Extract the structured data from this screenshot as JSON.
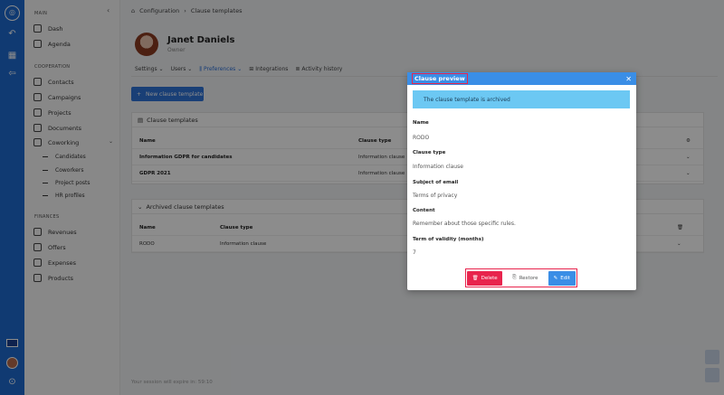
{
  "sidebar": {
    "section_main": "MAIN",
    "section_cooperation": "COOPERATION",
    "section_finances": "FINANCES",
    "main_items": [
      {
        "label": "Dash",
        "icon": "gauge-icon"
      },
      {
        "label": "Agenda",
        "icon": "calendar-icon"
      }
    ],
    "coop_items": [
      {
        "label": "Contacts",
        "icon": "contacts-icon"
      },
      {
        "label": "Campaigns",
        "icon": "megaphone-icon"
      },
      {
        "label": "Projects",
        "icon": "folder-icon"
      },
      {
        "label": "Documents",
        "icon": "document-icon"
      },
      {
        "label": "Coworking",
        "icon": "cog-icon"
      }
    ],
    "coworking_sub": [
      "Candidates",
      "Coworkers",
      "Project posts",
      "HR profiles"
    ],
    "finance_items": [
      {
        "label": "Revenues",
        "icon": "revenue-icon"
      },
      {
        "label": "Offers",
        "icon": "offer-icon"
      },
      {
        "label": "Expenses",
        "icon": "cart-icon"
      },
      {
        "label": "Products",
        "icon": "box-icon"
      }
    ]
  },
  "breadcrumb": {
    "root": "Configuration",
    "separator": "›",
    "current": "Clause templates"
  },
  "profile": {
    "name": "Janet Daniels",
    "role": "Owner"
  },
  "tabs": [
    {
      "label": "Settings",
      "caret": "⌄"
    },
    {
      "label": "Users",
      "caret": "⌄"
    },
    {
      "label": "Preferences",
      "caret": "⌄"
    },
    {
      "label": "Integrations",
      "caret": ""
    },
    {
      "label": "Activity history",
      "caret": ""
    }
  ],
  "new_button": "New clause template",
  "clause_card": {
    "title": "Clause templates",
    "col_name": "Name",
    "col_type": "Clause type",
    "rows": [
      {
        "name": "Information GDPR for candidates",
        "type": "Information clause"
      },
      {
        "name": "GDPR 2021",
        "type": "Information clause"
      }
    ]
  },
  "archived_card": {
    "title": "Archived clause templates",
    "col_name": "Name",
    "col_type": "Clause type",
    "rows": [
      {
        "name": "RODO",
        "type": "Information clause"
      }
    ]
  },
  "session_text": "Your session will expire in: 59:10",
  "modal": {
    "title": "Clause preview",
    "alert": "The clause template is archived",
    "fields": [
      {
        "label": "Name",
        "value": "RODO"
      },
      {
        "label": "Clause type",
        "value": "Information clause"
      },
      {
        "label": "Subject of email",
        "value": "Terms of privacy"
      },
      {
        "label": "Content",
        "value": "Remember about those specific rules."
      },
      {
        "label": "Term of validity (months)",
        "value": "7"
      }
    ],
    "delete_label": "Delete",
    "restore_label": "Restore",
    "edit_label": "Edit"
  },
  "colors": {
    "brand": "#1e6bd0",
    "modal_header": "#3a8ee6",
    "alert": "#6cc8f3",
    "danger": "#e8244d"
  }
}
